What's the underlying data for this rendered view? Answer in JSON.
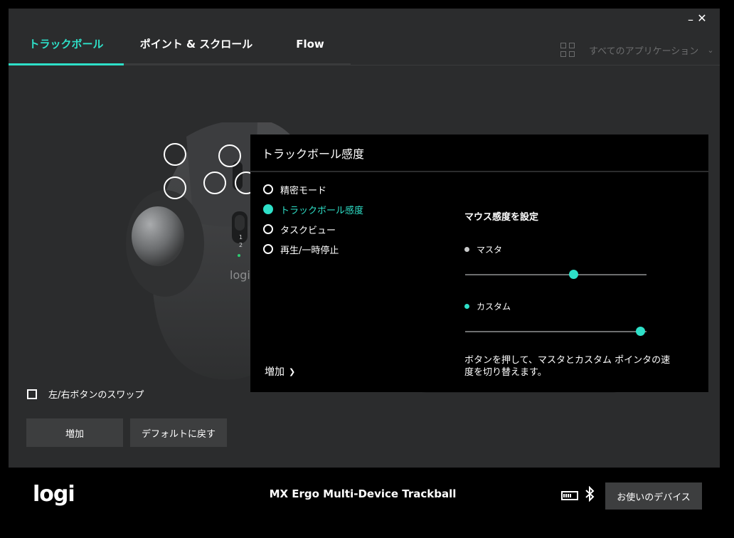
{
  "window": {
    "minimize_glyph": "–",
    "close_glyph": "✕"
  },
  "tabs": [
    {
      "label": "トラックボール",
      "active": true
    },
    {
      "label": "ポイント & スクロール",
      "active": false
    },
    {
      "label": "Flow",
      "active": false
    }
  ],
  "app_selector": {
    "label": "すべてのアプリケーション",
    "icon": "grid-icon"
  },
  "device_image": {
    "logo_text": "logi",
    "button_labels": [
      "1",
      "2"
    ]
  },
  "panel": {
    "title": "トラックボール感度",
    "options": [
      {
        "label": "精密モード",
        "selected": false
      },
      {
        "label": "トラックボール感度",
        "selected": true
      },
      {
        "label": "タスクビュー",
        "selected": false
      },
      {
        "label": "再生/一時停止",
        "selected": false
      }
    ],
    "more_label": "増加",
    "settings_title": "マウス感度を設定",
    "master": {
      "label": "マスタ",
      "level": 0.6
    },
    "custom": {
      "label": "カスタム",
      "level": 0.97
    },
    "hint": "ボタンを押して、マスタとカスタム ポインタの速度を切り替えます。"
  },
  "swap_label": "左/右ボタンのスワップ",
  "buttons": {
    "add": "増加",
    "reset": "デフォルトに戻す"
  },
  "footer": {
    "logo": "logi",
    "device_name": "MX Ergo Multi-Device Trackball",
    "devices_button": "お使いのデバイス"
  },
  "colors": {
    "accent": "#2ee0c8",
    "background": "#2b2c2d",
    "panel": "#000000"
  }
}
